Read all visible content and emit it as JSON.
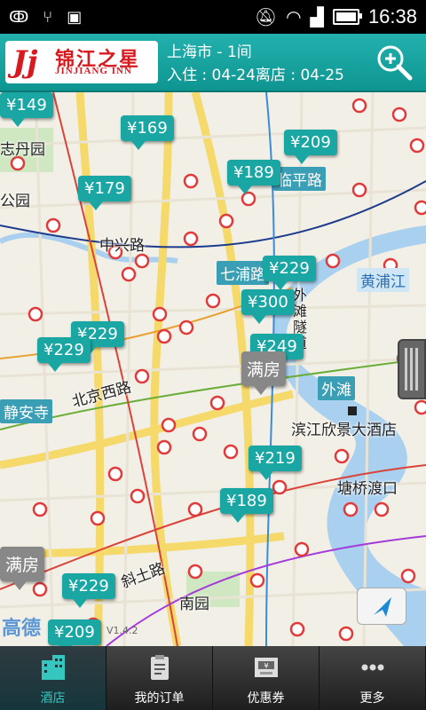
{
  "status_bar": {
    "time": "16:38"
  },
  "header": {
    "logo_cn": "锦江之星",
    "logo_en": "JINJIANG INN",
    "city_rooms": "上海市 - 1间",
    "dates": "入住 : 04-24离店 : 04-25"
  },
  "map": {
    "labels": [
      "志丹园",
      "公园",
      "中兴路",
      "北京西路",
      "静安寺",
      "斜土路",
      "南园",
      "滨江欣景大酒店",
      "塘桥渡口"
    ],
    "road_badges": [
      "临平路",
      "七浦路",
      "外滩",
      "黄浦江",
      "外滩隧道"
    ],
    "prices": [
      "¥149",
      "¥169",
      "¥209",
      "¥189",
      "¥179",
      "¥229",
      "¥300",
      "¥229",
      "¥229",
      "¥249",
      "¥219",
      "¥189",
      "¥229",
      "¥209"
    ],
    "full_labels": [
      "满房",
      "满房"
    ],
    "watermark": "高德",
    "version": "V1.4.2"
  },
  "bottom_nav": [
    {
      "label": "酒店",
      "icon": "hotel-building-icon"
    },
    {
      "label": "我的订单",
      "icon": "orders-clipboard-icon"
    },
    {
      "label": "优惠券",
      "icon": "coupon-icon"
    },
    {
      "label": "更多",
      "icon": "more-dots-icon"
    }
  ],
  "colors": {
    "accent": "#1aa7a4",
    "metro": "#e03a3a",
    "header": "#1aa7a4"
  }
}
